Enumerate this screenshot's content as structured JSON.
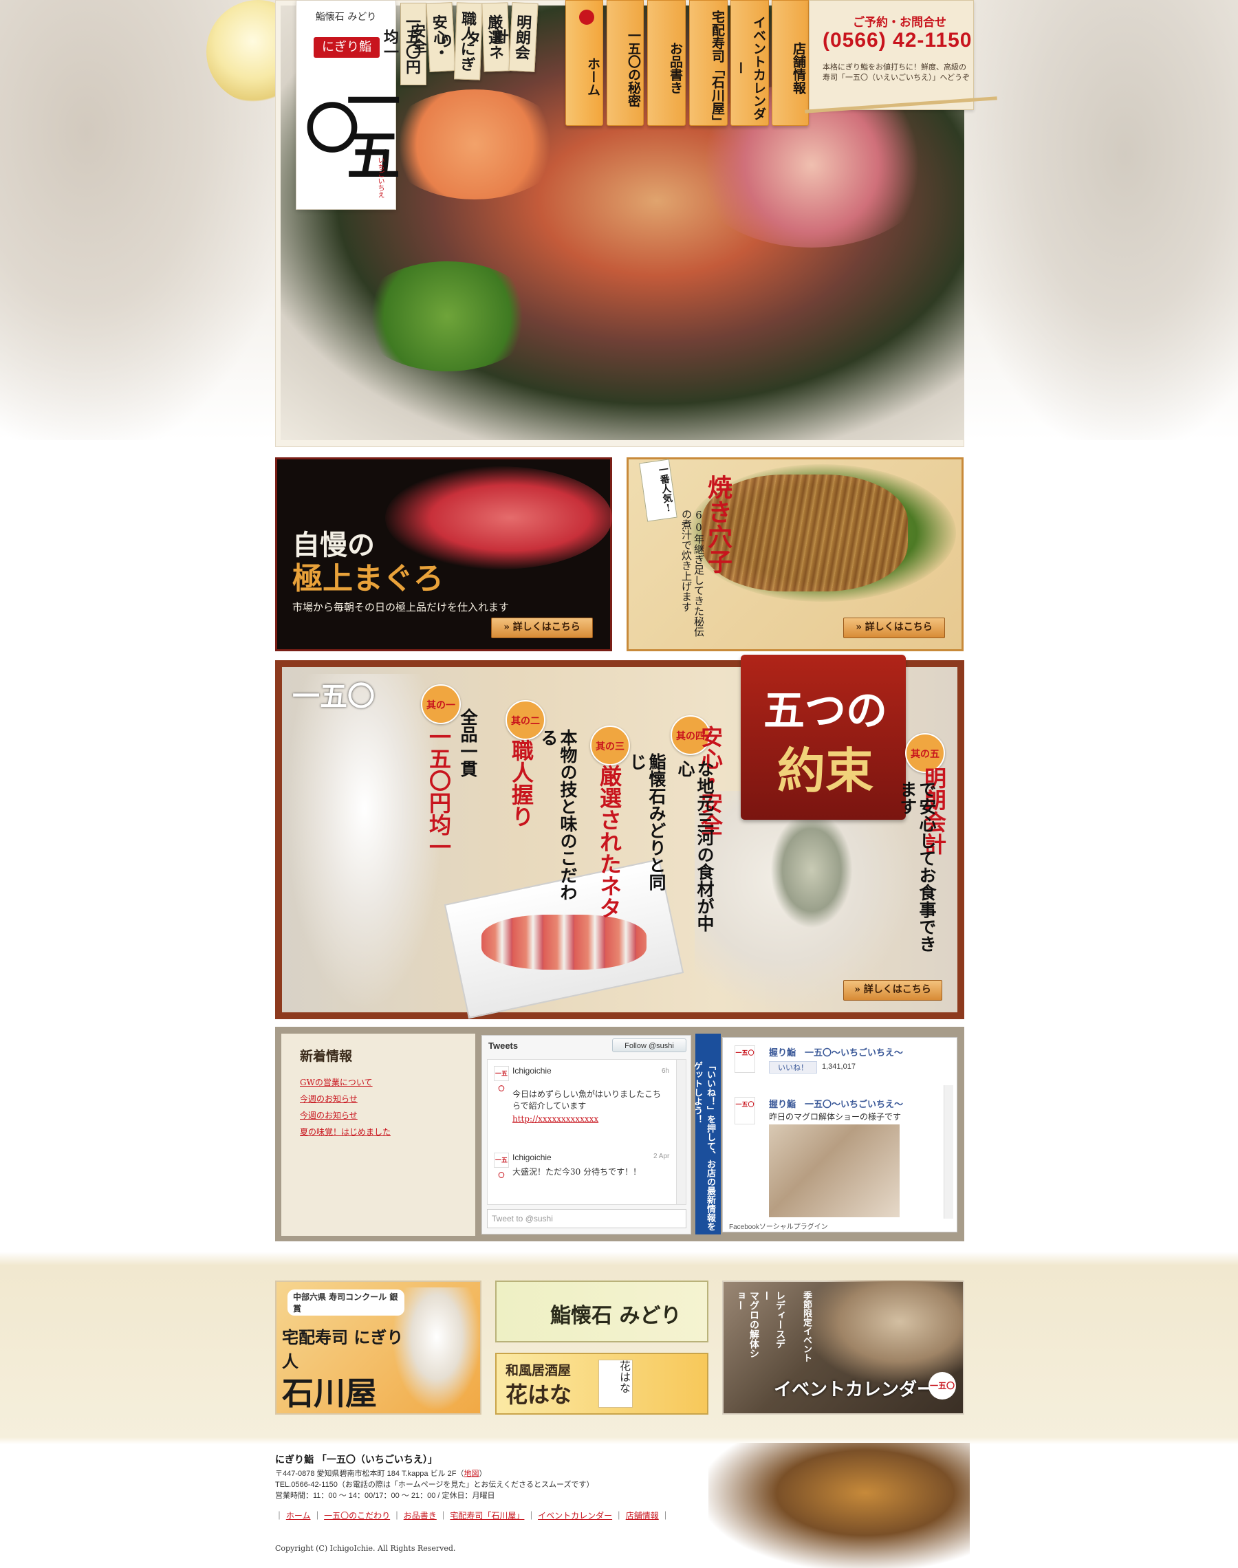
{
  "logo": {
    "top_text": "鮨懐石 みどり",
    "badge": "にぎり鮨",
    "mark": "一五〇",
    "reading": "いちごいちえ"
  },
  "tags": [
    "一五〇円均一",
    "安心・安全",
    "職人にぎり",
    "厳選ネタ",
    "明朗会計"
  ],
  "nav": {
    "items": [
      "ホーム",
      "一五〇の秘密",
      "お品書き",
      "宅配寿司「石川屋」",
      "イベントカレンダー",
      "店舗情報"
    ]
  },
  "contact": {
    "title": "ご予約・お問合せ",
    "phone": "(0566) 42-1150",
    "text": "本格にぎり鮨をお値打ちに！鮮度、高級の寿司「一五〇（いえいごいちえ）」へどうぞ"
  },
  "banner_tuna": {
    "title_line1": "自慢の",
    "title_line2": "極上まぐろ",
    "subtitle": "市場から毎朝その日の極上品だけを仕入れます",
    "button": "» 詳しくはこちら"
  },
  "banner_anago": {
    "badge": "一番人気!",
    "title": "焼き穴子",
    "subtitle": "60年継ぎ足してきた秘伝の煮汁で炊き上げます",
    "button": "» 詳しくはこちら"
  },
  "promise": {
    "logo": "一五〇",
    "title1": "五つの",
    "title2": "約束",
    "items": [
      {
        "badge": "其の一",
        "red": "一五〇円均一",
        "black": "全品一貫"
      },
      {
        "badge": "其の二",
        "red": "職人握り",
        "black": "本物の技と味のこだわる"
      },
      {
        "badge": "其の三",
        "red": "厳選されたネタ",
        "black": "鮨懐石みどりと同じ"
      },
      {
        "badge": "其の四",
        "red": "安心・安全",
        "black": "な地元三河の食材が中心"
      },
      {
        "badge": "其の五",
        "red": "明朗会計",
        "black": "で安心してお食事できます"
      }
    ],
    "button": "» 詳しくはこちら"
  },
  "news": {
    "title": "新着情報",
    "items": [
      "GWの営業について",
      "今週のお知らせ",
      "今週のお知らせ",
      "夏の味覚！はじめました"
    ]
  },
  "twitter": {
    "header": "Tweets",
    "follow": "Follow @sushi",
    "tweets": [
      {
        "name": "Ichigoichie",
        "time": "6h",
        "text": "今日はめずらしい魚がはいりましたこちらで紹介しています",
        "link": "http://xxxxxxxxxxxxx"
      },
      {
        "name": "Ichigoichie",
        "time": "2 Apr",
        "text": "大盛況！ただ今30 分待ちです！！",
        "link": ""
      }
    ],
    "placeholder": "Tweet to @sushi"
  },
  "facebook": {
    "side_text": "「いいね！」を押して、お店の最新情報をゲットしよう！",
    "page_name": "握り鮨　一五〇～いちごいちえ～",
    "like": "いいね！",
    "count": "1,341,017",
    "post_name": "握り鮨　一五〇～いちごいちえ～",
    "post_text": "昨日のマグロ解体ショーの様子です",
    "footer": "Facebookソーシャルプラグイン"
  },
  "bottom": {
    "ishikawa": {
      "award": "中部六県 寿司コンクール 銀賞",
      "sub": "宅配寿司 にぎり人",
      "name": "石川屋"
    },
    "midori": "鮨懐石 みどり",
    "hana": {
      "sub": "和風居酒屋",
      "name": "花はな",
      "mark": "花はな"
    },
    "event": {
      "title": "イベントカレンダー",
      "v1": "マグロの解体ショー",
      "v2": "レディースデー",
      "v3": "季節限定イベント",
      "mark": "一五〇"
    }
  },
  "footer": {
    "name": "にぎり鮨 「一五〇（いちごいちえ）」",
    "address": "〒447-0878 愛知県碧南市松本町 184 T.kappa ビル 2F",
    "map": "地図",
    "tel": "TEL.0566-42-1150（お電話の際は「ホームページを見た」とお伝えくださるとスムーズです）",
    "hours": "営業時間：11：00 〜 14：00/17：00 〜 21：00 / 定休日：月曜日",
    "links": [
      "ホーム",
      "一五〇のこだわり",
      "お品書き",
      "宅配寿司「石川屋」",
      "イベントカレンダー",
      "店舗情報"
    ],
    "copyright": "Copyright (C) IchigoIchie. All Rights Reserved."
  }
}
